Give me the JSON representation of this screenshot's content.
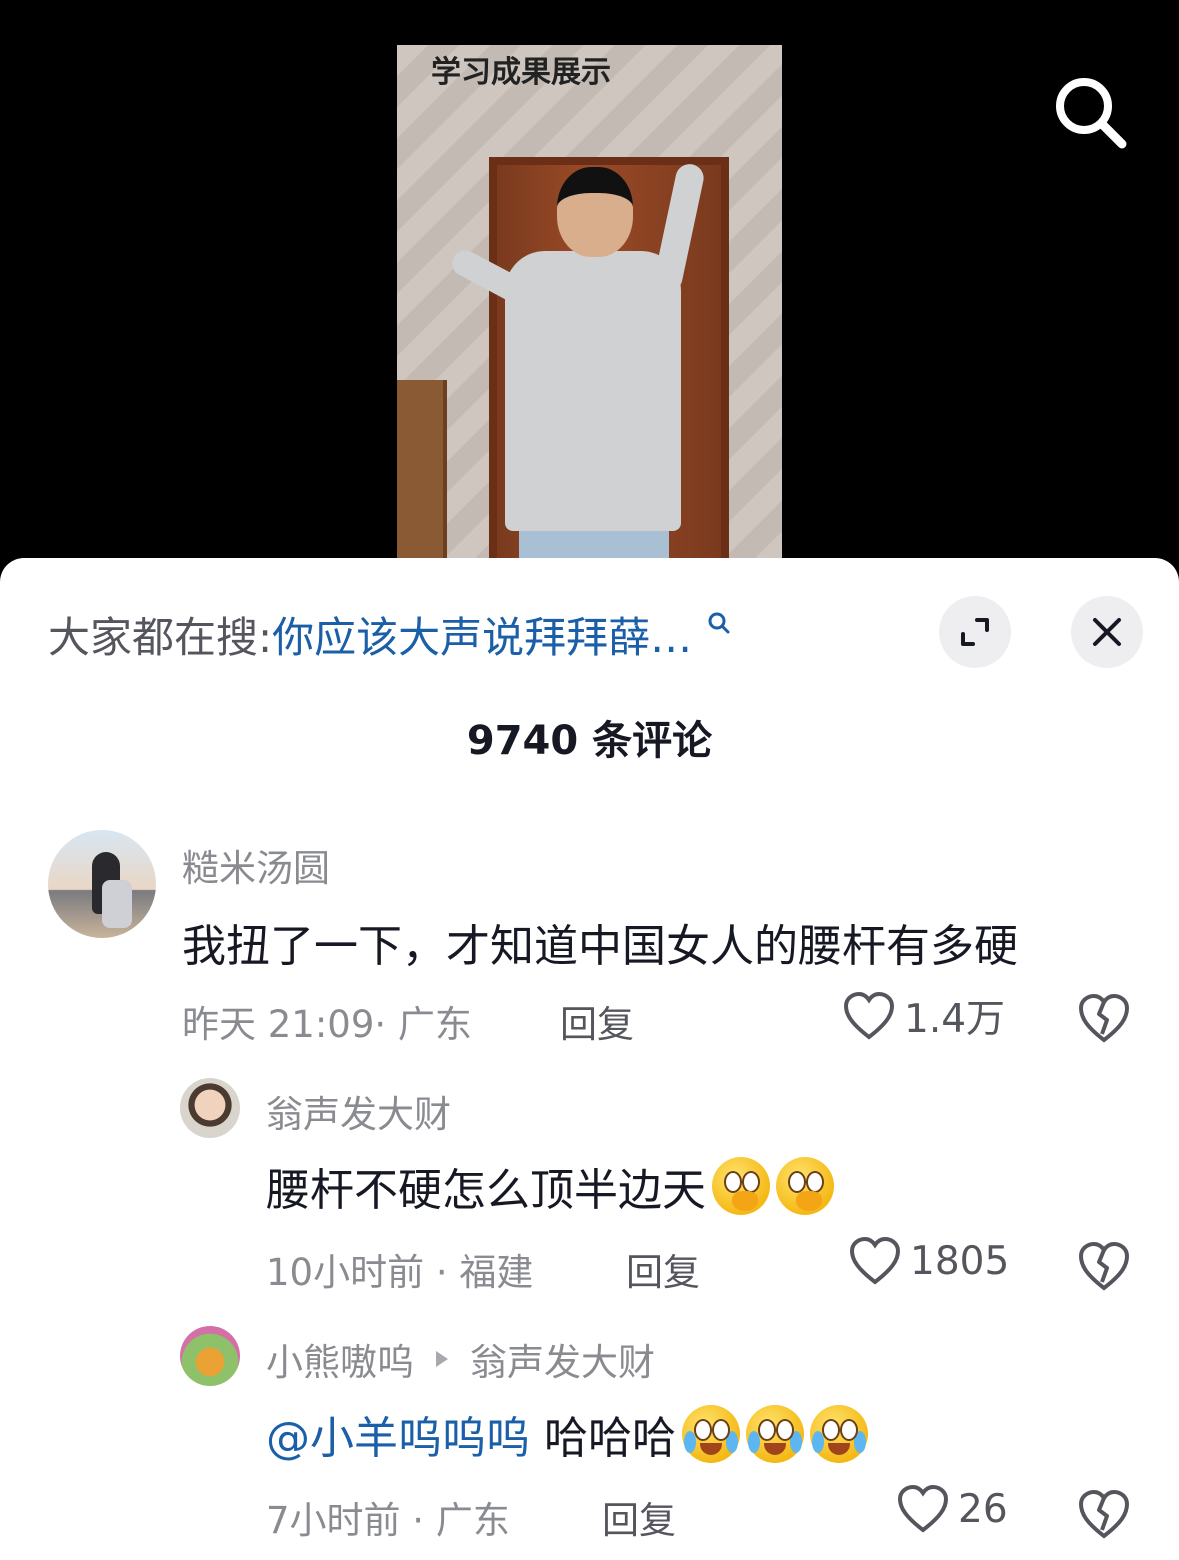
{
  "video": {
    "caption": "学习成果展示"
  },
  "sheet": {
    "search_prefix": "大家都在搜:",
    "search_query": "你应该大声说拜拜薛…",
    "comment_count": "9740 条评论"
  },
  "comments": [
    {
      "username": "糙米汤圆",
      "text": "我扭了一下，才知道中国女人的腰杆有多硬",
      "time_location": "昨天 21:09· 广东",
      "reply_label": "回复",
      "likes": "1.4万"
    },
    {
      "username": "翁声发大财",
      "text": "腰杆不硬怎么顶半边天",
      "emojis": [
        "thinking-emoji",
        "thinking-emoji"
      ],
      "time_location": "10小时前 · 福建",
      "reply_label": "回复",
      "likes": "1805"
    },
    {
      "username": "小熊嗷呜",
      "reply_to": "翁声发大财",
      "mention": "@小羊呜呜呜",
      "text": " 哈哈哈",
      "emojis": [
        "crying-laugh-emoji",
        "crying-laugh-emoji",
        "crying-laugh-emoji"
      ],
      "time_location": "7小时前 · 广东",
      "reply_label": "回复",
      "likes": "26"
    }
  ],
  "colors": {
    "link": "#1a5fa8",
    "muted": "#8a8b91",
    "text": "#161823"
  }
}
